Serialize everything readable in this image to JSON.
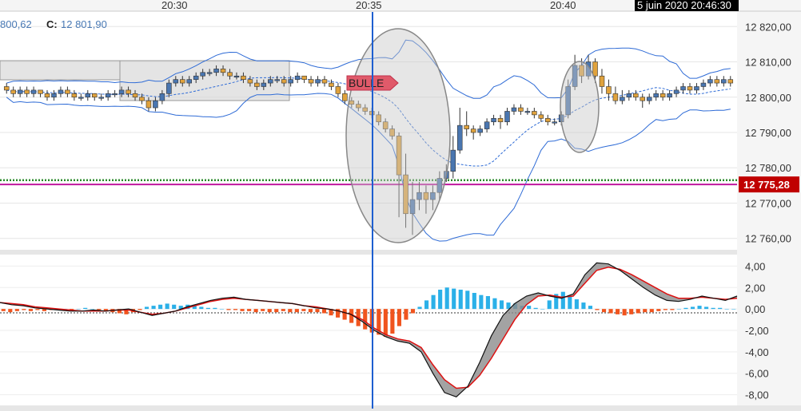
{
  "header": {
    "partial_value": "800,62",
    "close_key": "C:",
    "close_value": "12 801,90",
    "timestamp": "5 juin 2020 20:46:30"
  },
  "time_labels": [
    "20:30",
    "20:35",
    "20:40"
  ],
  "price_axis": [
    "12 820,00",
    "12 810,00",
    "12 800,00",
    "12 790,00",
    "12 780,00",
    "12 770,00",
    "12 760,00"
  ],
  "current_price": {
    "label": "12 775,28",
    "value": 12775.28,
    "color": "#c00000"
  },
  "annotation": {
    "label": "BULLE",
    "color": "#e05a6a"
  },
  "colors": {
    "bull": "#4a76b0",
    "bear": "#e0a23c",
    "band": "#2e6bd6",
    "macd_pos": "#2bb0e8",
    "macd_neg": "#f0541e",
    "cursor": "#1e5fd0",
    "support_line": "#2a8a2a",
    "price_line": "#c0189e"
  },
  "chart_data": [
    {
      "type": "candlestick",
      "ylim": [
        12757,
        12823
      ],
      "yticks": [
        12820,
        12810,
        12800,
        12790,
        12780,
        12770,
        12760
      ],
      "candles": [
        [
          12803,
          12802,
          12804,
          12801
        ],
        [
          12802,
          12801,
          12803,
          12800
        ],
        [
          12801,
          12802,
          12803,
          12800
        ],
        [
          12802,
          12801,
          12803,
          12800
        ],
        [
          12801,
          12802,
          12803,
          12800
        ],
        [
          12802,
          12801,
          12802,
          12800
        ],
        [
          12801,
          12800,
          12802,
          12799
        ],
        [
          12800,
          12801,
          12802,
          12799
        ],
        [
          12801,
          12802,
          12803,
          12800
        ],
        [
          12802,
          12801,
          12803,
          12800
        ],
        [
          12801,
          12800,
          12802,
          12799
        ],
        [
          12800,
          12800,
          12801,
          12799
        ],
        [
          12800,
          12801,
          12802,
          12799
        ],
        [
          12801,
          12800,
          12801,
          12799
        ],
        [
          12800,
          12800,
          12801,
          12799
        ],
        [
          12800,
          12801,
          12802,
          12799
        ],
        [
          12801,
          12801,
          12802,
          12800
        ],
        [
          12801,
          12802,
          12803,
          12800
        ],
        [
          12802,
          12801,
          12803,
          12800
        ],
        [
          12801,
          12800,
          12802,
          12799
        ],
        [
          12800,
          12799,
          12801,
          12798
        ],
        [
          12799,
          12797,
          12800,
          12796
        ],
        [
          12797,
          12799,
          12800,
          12796
        ],
        [
          12799,
          12801,
          12802,
          12798
        ],
        [
          12801,
          12804,
          12805,
          12800
        ],
        [
          12804,
          12805,
          12806,
          12803
        ],
        [
          12805,
          12804,
          12806,
          12803
        ],
        [
          12804,
          12805,
          12806,
          12803
        ],
        [
          12805,
          12806,
          12807,
          12804
        ],
        [
          12806,
          12807,
          12808,
          12805
        ],
        [
          12807,
          12807,
          12808,
          12806
        ],
        [
          12807,
          12808,
          12809,
          12806
        ],
        [
          12808,
          12807,
          12809,
          12806
        ],
        [
          12807,
          12806,
          12808,
          12805
        ],
        [
          12806,
          12806,
          12807,
          12805
        ],
        [
          12806,
          12805,
          12807,
          12804
        ],
        [
          12805,
          12804,
          12806,
          12803
        ],
        [
          12804,
          12803,
          12805,
          12802
        ],
        [
          12803,
          12804,
          12805,
          12802
        ],
        [
          12804,
          12805,
          12806,
          12803
        ],
        [
          12805,
          12805,
          12806,
          12804
        ],
        [
          12805,
          12804,
          12806,
          12803
        ],
        [
          12804,
          12805,
          12806,
          12803
        ],
        [
          12805,
          12806,
          12807,
          12804
        ],
        [
          12806,
          12805,
          12806,
          12804
        ],
        [
          12805,
          12804,
          12806,
          12803
        ],
        [
          12804,
          12805,
          12806,
          12803
        ],
        [
          12805,
          12804,
          12806,
          12803
        ],
        [
          12804,
          12803,
          12805,
          12802
        ],
        [
          12803,
          12801,
          12804,
          12800
        ],
        [
          12801,
          12799,
          12802,
          12798
        ],
        [
          12799,
          12798,
          12800,
          12797
        ],
        [
          12798,
          12797,
          12799,
          12796
        ],
        [
          12797,
          12796,
          12798,
          12795
        ],
        [
          12796,
          12795,
          12797,
          12794
        ],
        [
          12795,
          12793,
          12796,
          12792
        ],
        [
          12793,
          12791,
          12794,
          12790
        ],
        [
          12791,
          12789,
          12792,
          12788
        ],
        [
          12789,
          12778,
          12790,
          12766
        ],
        [
          12778,
          12767,
          12784,
          12763
        ],
        [
          12767,
          12771,
          12776,
          12761
        ],
        [
          12771,
          12773,
          12776,
          12768
        ],
        [
          12773,
          12771,
          12775,
          12767
        ],
        [
          12771,
          12773,
          12775,
          12768
        ],
        [
          12773,
          12777,
          12779,
          12771
        ],
        [
          12777,
          12779,
          12781,
          12776
        ],
        [
          12779,
          12785,
          12789,
          12777
        ],
        [
          12785,
          12792,
          12797,
          12784
        ],
        [
          12792,
          12791,
          12796,
          12789
        ],
        [
          12791,
          12790,
          12792,
          12788
        ],
        [
          12790,
          12791,
          12792,
          12789
        ],
        [
          12791,
          12793,
          12794,
          12790
        ],
        [
          12793,
          12794,
          12795,
          12792
        ],
        [
          12794,
          12793,
          12795,
          12791
        ],
        [
          12793,
          12796,
          12797,
          12792
        ],
        [
          12796,
          12797,
          12798,
          12795
        ],
        [
          12797,
          12796,
          12798,
          12795
        ],
        [
          12796,
          12796,
          12797,
          12795
        ],
        [
          12796,
          12795,
          12797,
          12794
        ],
        [
          12795,
          12794,
          12796,
          12793
        ],
        [
          12794,
          12793,
          12795,
          12792
        ],
        [
          12793,
          12793,
          12794,
          12792
        ],
        [
          12793,
          12795,
          12796,
          12792
        ],
        [
          12795,
          12803,
          12805,
          12794
        ],
        [
          12803,
          12809,
          12812,
          12802
        ],
        [
          12809,
          12806,
          12811,
          12804
        ],
        [
          12806,
          12810,
          12812,
          12805
        ],
        [
          12810,
          12806,
          12811,
          12804
        ],
        [
          12806,
          12803,
          12808,
          12801
        ],
        [
          12803,
          12801,
          12805,
          12799
        ],
        [
          12801,
          12799,
          12803,
          12798
        ],
        [
          12799,
          12800,
          12802,
          12798
        ],
        [
          12800,
          12801,
          12802,
          12799
        ],
        [
          12801,
          12800,
          12802,
          12799
        ],
        [
          12800,
          12799,
          12801,
          12797
        ],
        [
          12799,
          12800,
          12801,
          12798
        ],
        [
          12800,
          12801,
          12802,
          12799
        ],
        [
          12801,
          12800,
          12802,
          12799
        ],
        [
          12800,
          12801,
          12802,
          12799
        ],
        [
          12801,
          12802,
          12803,
          12800
        ],
        [
          12802,
          12803,
          12804,
          12801
        ],
        [
          12803,
          12802,
          12804,
          12801
        ],
        [
          12802,
          12803,
          12804,
          12801
        ],
        [
          12803,
          12804,
          12805,
          12802
        ],
        [
          12804,
          12805,
          12806,
          12803
        ],
        [
          12805,
          12804,
          12806,
          12803
        ],
        [
          12804,
          12805,
          12806,
          12803
        ],
        [
          12805,
          12804,
          12806,
          12803
        ]
      ],
      "support_level": 12776.5,
      "price_level": 12775.28
    },
    {
      "type": "histogram+lines",
      "ylim": [
        -9,
        5
      ],
      "yticks": [
        4,
        2,
        0,
        -2,
        -4,
        -6,
        -8
      ],
      "ytick_labels": [
        "4,00",
        "2,00",
        "0,00",
        "-2,00",
        "-4,00",
        "-6,00",
        "-8,00"
      ],
      "histogram": [
        -0.2,
        -0.3,
        -0.2,
        -0.1,
        -0.2,
        -0.1,
        -0.2,
        -0.1,
        -0.1,
        0.0,
        -0.1,
        0.0,
        0.1,
        0.0,
        -0.1,
        -0.2,
        -0.3,
        -0.4,
        -0.5,
        -0.3,
        -0.1,
        0.2,
        0.3,
        0.4,
        0.5,
        0.4,
        0.3,
        0.4,
        0.3,
        0.2,
        0.1,
        0.1,
        0.0,
        -0.1,
        -0.1,
        -0.2,
        -0.2,
        -0.3,
        -0.2,
        -0.3,
        -0.3,
        -0.2,
        -0.3,
        -0.3,
        -0.2,
        -0.3,
        -0.3,
        -0.4,
        -0.6,
        -0.8,
        -1.0,
        -1.3,
        -1.6,
        -1.9,
        -2.2,
        -2.4,
        -2.6,
        -2.3,
        -1.6,
        -1.0,
        -0.4,
        0.2,
        0.8,
        1.3,
        1.8,
        2.0,
        1.9,
        1.8,
        1.7,
        1.5,
        1.3,
        1.2,
        1.0,
        0.8,
        0.6,
        0.5,
        0.3,
        0.3,
        0.1,
        0.0,
        0.8,
        1.4,
        1.6,
        1.2,
        0.9,
        0.6,
        0.3,
        -0.1,
        -0.3,
        -0.4,
        -0.5,
        -0.6,
        -0.5,
        -0.4,
        -0.3,
        -0.3,
        -0.2,
        -0.1,
        -0.1,
        0.0,
        0.1,
        0.2,
        0.3,
        0.2,
        0.1,
        0.1,
        0.0,
        0.0
      ],
      "macd": [
        0.6,
        0.4,
        0.3,
        0.1,
        0.0,
        -0.1,
        -0.2,
        -0.2,
        -0.1,
        -0.2,
        -0.1,
        0.0,
        -0.3,
        -0.6,
        -0.4,
        -0.2,
        0.2,
        0.5,
        0.8,
        1.0,
        1.1,
        0.9,
        0.8,
        0.7,
        0.6,
        0.5,
        0.3,
        0.1,
        0.0,
        -0.2,
        -0.5,
        -1.2,
        -2.0,
        -2.6,
        -3.0,
        -3.2,
        -4.0,
        -6.0,
        -7.8,
        -8.2,
        -7.2,
        -5.0,
        -2.5,
        -0.6,
        0.5,
        1.2,
        1.5,
        1.2,
        1.0,
        1.4,
        3.2,
        4.3,
        4.2,
        3.6,
        2.8,
        2.0,
        1.3,
        0.8,
        0.7,
        0.9,
        1.2,
        1.0,
        0.8,
        1.2
      ],
      "signal": [
        0.6,
        0.5,
        0.4,
        0.2,
        0.1,
        0.0,
        -0.1,
        -0.2,
        -0.2,
        -0.2,
        -0.1,
        -0.1,
        -0.3,
        -0.5,
        -0.4,
        -0.2,
        0.1,
        0.4,
        0.7,
        0.9,
        1.0,
        0.9,
        0.8,
        0.7,
        0.6,
        0.5,
        0.3,
        0.2,
        0.0,
        -0.2,
        -0.5,
        -1.0,
        -1.8,
        -2.4,
        -2.8,
        -3.0,
        -3.6,
        -5.2,
        -6.6,
        -7.4,
        -7.3,
        -6.2,
        -4.6,
        -2.8,
        -1.0,
        0.4,
        1.2,
        1.3,
        1.1,
        1.2,
        2.4,
        3.6,
        3.9,
        3.7,
        3.2,
        2.6,
        2.0,
        1.4,
        1.0,
        1.0,
        1.1,
        1.0,
        0.9,
        1.0
      ]
    }
  ]
}
